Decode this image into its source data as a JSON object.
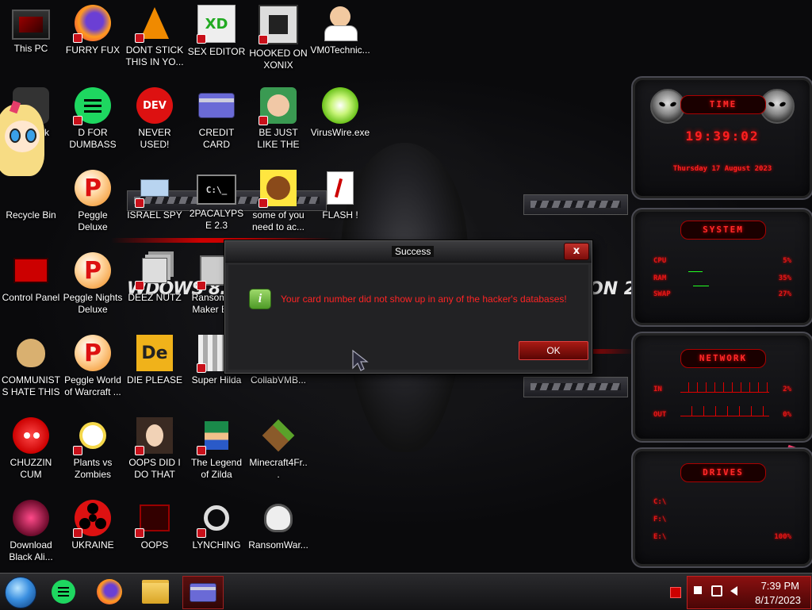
{
  "desktop": {
    "icons": [
      {
        "label": "This PC"
      },
      {
        "label": "FURRY FUX"
      },
      {
        "label": "DONT STICK THIS IN YO..."
      },
      {
        "label": "SEX EDITOR"
      },
      {
        "label": "HOOKED ON XONIX"
      },
      {
        "label": "VM0Technic..."
      },
      {
        "label": "rk"
      },
      {
        "label": "D FOR DUMBASS"
      },
      {
        "label": "NEVER USED!"
      },
      {
        "label": "CREDIT CARD CHECKER"
      },
      {
        "label": "BE JUST LIKE THE DUDE!"
      },
      {
        "label": "VirusWire.exe"
      },
      {
        "label": "Recycle Bin"
      },
      {
        "label": "Peggle Deluxe"
      },
      {
        "label": "ISRAEL SPY"
      },
      {
        "label": "2PACALYPSE 2.3"
      },
      {
        "label": "some of you need to ac..."
      },
      {
        "label": "FLASH !"
      },
      {
        "label": "Control Panel"
      },
      {
        "label": "Peggle Nights Deluxe"
      },
      {
        "label": "DEEZ NUTZ"
      },
      {
        "label": "Ransomw... Maker Bu..."
      },
      {
        "label": "COMMUNISTS HATE THIS G..."
      },
      {
        "label": "Peggle World of Warcraft ..."
      },
      {
        "label": "DIE PLEASE"
      },
      {
        "label": "Super Hilda"
      },
      {
        "label": "CollabVMB..."
      },
      {
        "label": "CHUZZIN CUM"
      },
      {
        "label": "Plants vs Zombies"
      },
      {
        "label": "OOPS DID I DO THAT"
      },
      {
        "label": "The Legend of Zilda"
      },
      {
        "label": "Minecraft4Fr..."
      },
      {
        "label": "Download Black Ali..."
      },
      {
        "label": "UKRAINE"
      },
      {
        "label": "OOPS"
      },
      {
        "label": "LYNCHING"
      },
      {
        "label": "RansomWar..."
      }
    ],
    "icon_glyphs": {
      "dev": "DEV",
      "peggle": "P",
      "die": "De",
      "cmd": "C:\\_"
    },
    "wallpaper": {
      "left_text": "WDOWS 8.1",
      "right_text": "ON 20"
    }
  },
  "gadgets": {
    "time": {
      "title": "TIME",
      "clock": "19:39:02",
      "date": "Thursday 17 August 2023"
    },
    "system": {
      "title": "SYSTEM",
      "rows": [
        {
          "label": "CPU",
          "value": "5%"
        },
        {
          "label": "RAM",
          "value": "35%"
        },
        {
          "label": "SWAP",
          "value": "27%"
        }
      ]
    },
    "network": {
      "title": "NETWORK",
      "rows": [
        {
          "label": "IN",
          "value": "2%"
        },
        {
          "label": "OUT",
          "value": "0%"
        }
      ]
    },
    "drives": {
      "title": "DRIVES",
      "rows": [
        {
          "label": "C:\\"
        },
        {
          "label": "F:\\"
        },
        {
          "label": "E:\\",
          "value": "100%"
        }
      ]
    }
  },
  "dialog": {
    "title": "Success",
    "close": "x",
    "info_glyph": "i",
    "message": "Your card number did not show up in any of the hacker's databases!",
    "ok_label": "OK"
  },
  "taskbar": {
    "time": "7:39 PM",
    "date": "8/17/2023"
  },
  "colors": {
    "accent": "#cc1010",
    "message_text": "#ff2424"
  }
}
